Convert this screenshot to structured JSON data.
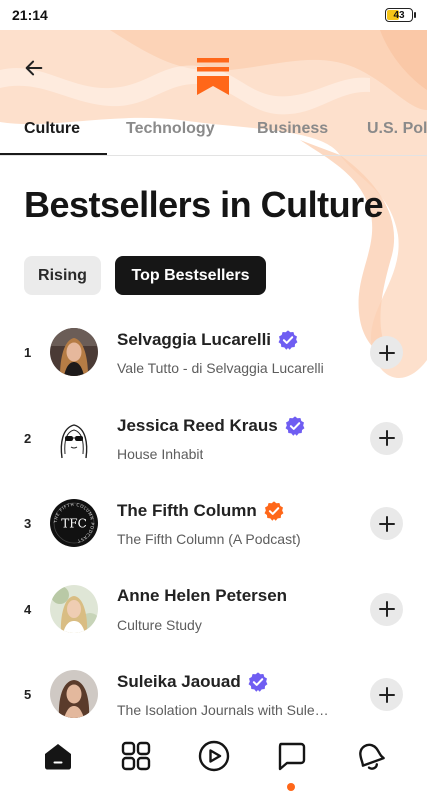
{
  "status_bar": {
    "time": "21:14",
    "battery": "43",
    "battery_level": 0.43
  },
  "colors": {
    "accent": "#ff6719",
    "verified_purple": "#6f5df2",
    "verified_orange": "#ff6719"
  },
  "header": {
    "back_icon": "arrow-left-icon",
    "logo_icon": "substack-logo-icon"
  },
  "tabs": [
    {
      "label": "Culture",
      "active": true
    },
    {
      "label": "Technology",
      "active": false
    },
    {
      "label": "Business",
      "active": false
    },
    {
      "label": "U.S. Pol",
      "active": false
    }
  ],
  "page": {
    "title": "Bestsellers in Culture"
  },
  "filters": {
    "rising": "Rising",
    "top": "Top Bestsellers",
    "selected": "Top Bestsellers"
  },
  "publications": [
    {
      "rank": "1",
      "name": "Selvaggia Lucarelli",
      "publication": "Vale Tutto - di Selvaggia Lucarelli",
      "badge": "purple"
    },
    {
      "rank": "2",
      "name": "Jessica Reed Kraus",
      "publication": "House Inhabit",
      "badge": "purple"
    },
    {
      "rank": "3",
      "name": "The Fifth Column",
      "publication": "The Fifth Column (A Podcast)",
      "badge": "orange",
      "avatar_text": "TFC",
      "avatar_ring_text": "THE FIFTH COLUMN PODCAST"
    },
    {
      "rank": "4",
      "name": "Anne Helen Petersen",
      "publication": "Culture Study",
      "badge": "none"
    },
    {
      "rank": "5",
      "name": "Suleika Jaouad",
      "publication": "The Isolation Journals with Sule…",
      "badge": "purple"
    }
  ],
  "bottom_nav": [
    {
      "icon": "home-icon",
      "active": true
    },
    {
      "icon": "grid-icon",
      "active": false
    },
    {
      "icon": "play-circle-icon",
      "active": false
    },
    {
      "icon": "chat-bubble-icon",
      "active": false,
      "has_notification": true
    },
    {
      "icon": "bell-icon",
      "active": false
    }
  ]
}
